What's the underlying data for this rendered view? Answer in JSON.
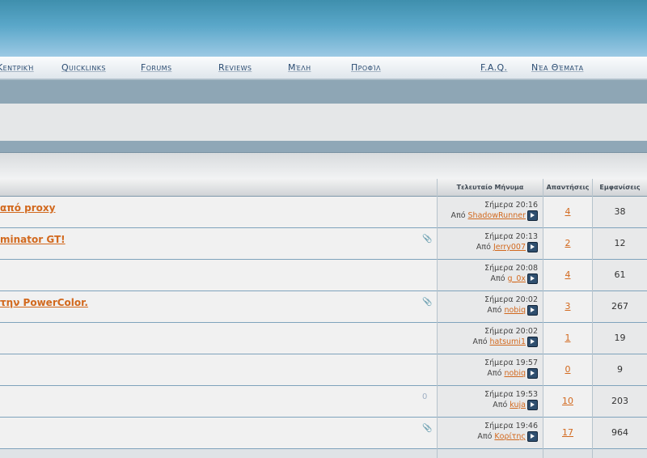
{
  "nav": {
    "items": [
      {
        "label": "Κεντρική"
      },
      {
        "label": "Quicklinks"
      },
      {
        "label": "Forums"
      },
      {
        "label": "Reviews"
      },
      {
        "label": "Μέλη"
      },
      {
        "label": "Προφίλ"
      },
      {
        "label": "F.A.Q."
      },
      {
        "label": "Νέα Θέματα"
      }
    ]
  },
  "table": {
    "headers": {
      "last_post": "Τελευταίο Μήνυμα",
      "replies": "Απαντήσεις",
      "views": "Εμφανίσεις"
    },
    "rows": [
      {
        "title": "από proxy",
        "attach": "",
        "date": "Σήμερα 20:16",
        "by_prefix": "Από",
        "user": "ShadowRunner",
        "replies": "4",
        "views": "38"
      },
      {
        "title": "minator GT!",
        "attach": "📎",
        "date": "Σήμερα 20:13",
        "by_prefix": "Από",
        "user": "Jerry007",
        "replies": "2",
        "views": "12"
      },
      {
        "title": "",
        "attach": "",
        "date": "Σήμερα 20:08",
        "by_prefix": "Από",
        "user": "g_0x",
        "replies": "4",
        "views": "61"
      },
      {
        "title": "την PowerColor.",
        "attach": "📎",
        "date": "Σήμερα 20:02",
        "by_prefix": "Από",
        "user": "nobiq",
        "replies": "3",
        "views": "267"
      },
      {
        "title": "",
        "attach": "",
        "date": "Σήμερα 20:02",
        "by_prefix": "Από",
        "user": "hatsumi1",
        "replies": "1",
        "views": "19"
      },
      {
        "title": "",
        "attach": "",
        "date": "Σήμερα 19:57",
        "by_prefix": "Από",
        "user": "nobiq",
        "replies": "0",
        "views": "9"
      },
      {
        "title": "",
        "attach": "0",
        "date": "Σήμερα 19:53",
        "by_prefix": "Από",
        "user": "kuja",
        "replies": "10",
        "views": "203"
      },
      {
        "title": "",
        "attach": "📎",
        "date": "Σήμερα 19:46",
        "by_prefix": "Από",
        "user": "Κορίτης",
        "replies": "17",
        "views": "964"
      }
    ]
  }
}
